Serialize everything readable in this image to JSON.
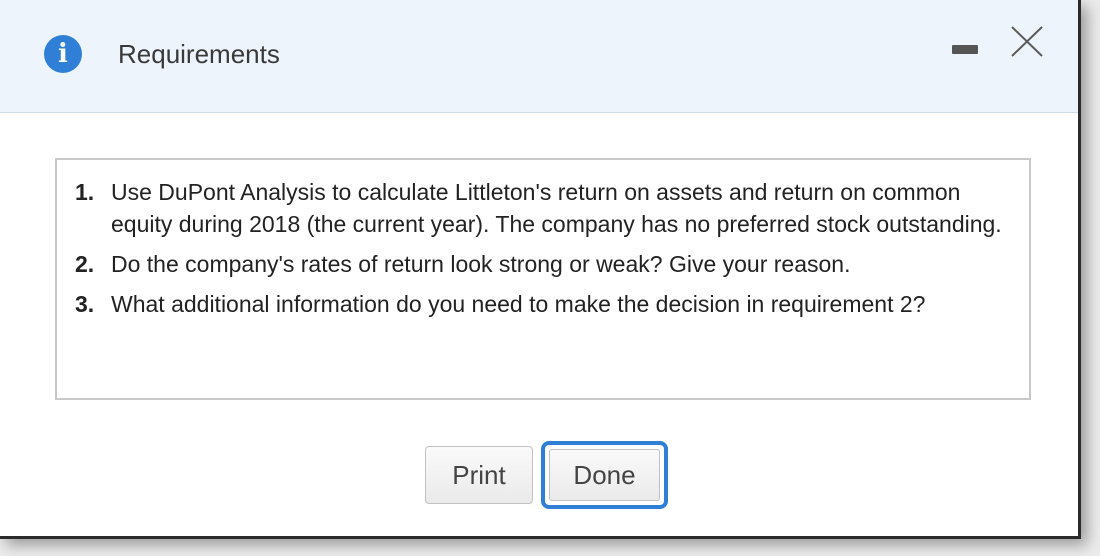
{
  "dialog": {
    "title": "Requirements",
    "info_icon": "info-icon",
    "minimize_icon": "minimize-icon",
    "close_icon": "close-icon",
    "accent_color": "#2f7fd6",
    "header_background": "#eef4fb"
  },
  "requirements": [
    {
      "number": "1.",
      "text": "Use DuPont Analysis to calculate Littleton's return on assets and return on common equity during 2018 (the current year). The company has no preferred stock outstanding."
    },
    {
      "number": "2.",
      "text": "Do the company's rates of return look strong or weak? Give your reason."
    },
    {
      "number": "3.",
      "text": "What additional information do you need to make the decision in requirement 2?"
    }
  ],
  "buttons": {
    "print_label": "Print",
    "done_label": "Done"
  }
}
